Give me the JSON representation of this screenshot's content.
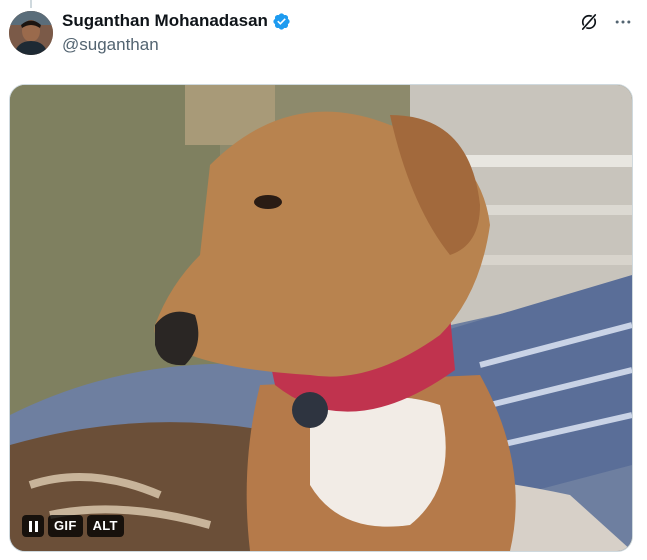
{
  "author": {
    "display_name": "Suganthan Mohanadasan",
    "handle": "@suganthan",
    "verified": true,
    "verified_color": "#1d9bf0"
  },
  "icons": {
    "grok": "grok-icon",
    "more": "more-icon",
    "verified": "verified-badge-icon"
  },
  "media": {
    "controls": {
      "pause_icon": "pause-icon",
      "gif_label": "GIF",
      "alt_label": "ALT"
    }
  }
}
